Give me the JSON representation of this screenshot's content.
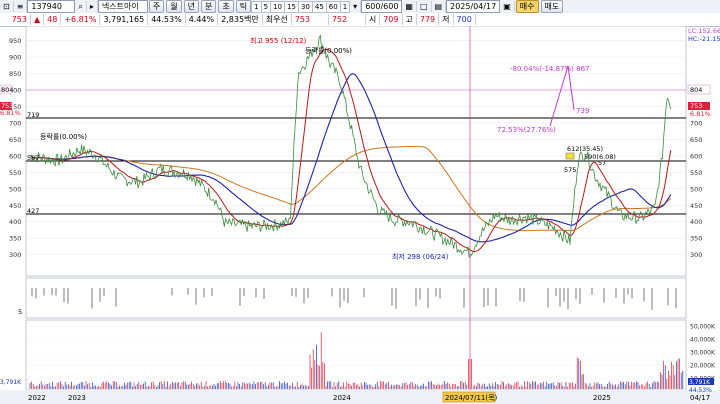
{
  "toolbar": {
    "code": "137940",
    "name": "넥스트아이",
    "periods": [
      "주",
      "월",
      "년",
      "분",
      "초",
      "틱"
    ],
    "minutes": [
      "1",
      "5",
      "10",
      "15",
      "30",
      "45",
      "60",
      "1"
    ],
    "count": "600/600",
    "date": "2025/04/17",
    "buy_label": "매수",
    "sell_label": "매도"
  },
  "quote": {
    "price": "753",
    "change": "48",
    "change_pct": "+6.81%",
    "volume": "3,791,165",
    "vol_ratio": "44.53%",
    "turnover": "4.44%",
    "amount": "2,835백만",
    "priority_label": "최우선",
    "last": "753",
    "open_val": "752",
    "open_label": "시",
    "open_price": "709",
    "high_label": "고",
    "high_price": "779",
    "low_label": "저",
    "low_price": "700"
  },
  "chart": {
    "y_ticks": [
      "950",
      "900",
      "850",
      "800",
      "750",
      "700",
      "650",
      "600",
      "550",
      "500",
      "450",
      "400",
      "350",
      "300"
    ],
    "right_ticks": [
      "700",
      "650",
      "600",
      "550",
      "500",
      "450",
      "400",
      "350",
      "300"
    ],
    "left_levels": [
      "804",
      "753",
      "6.81%",
      "719",
      "587",
      "427"
    ],
    "right_tags": [
      "804",
      "753",
      "6.81%"
    ],
    "legend": [
      "LC:152.66",
      "HC:-21.15"
    ],
    "high_note": "최고 955 (12/12)",
    "low_note": "최저 298 (06/24)",
    "stat_note1": "등락률(0.00%)",
    "stat_note2": "등락률(0.00%)",
    "measure1": "-80.04%(-14.87%) 867",
    "measure2": "72.53%(27.76%)",
    "measure3": "739",
    "box_a": "612(35.45)",
    "box_b": "590(6.08)",
    "box_c": "575",
    "box_d": "57",
    "vol_ticks": [
      "50,000K",
      "40,000K",
      "30,000K",
      "20,000K",
      "10,000K"
    ],
    "vol_tags": [
      "3,791K",
      "44.53%"
    ],
    "sub_tick": "5",
    "x_labels": [
      "2022",
      "2023",
      "2024",
      "2025",
      "04/17"
    ],
    "cursor_date": "2024/07/11(목)"
  }
}
